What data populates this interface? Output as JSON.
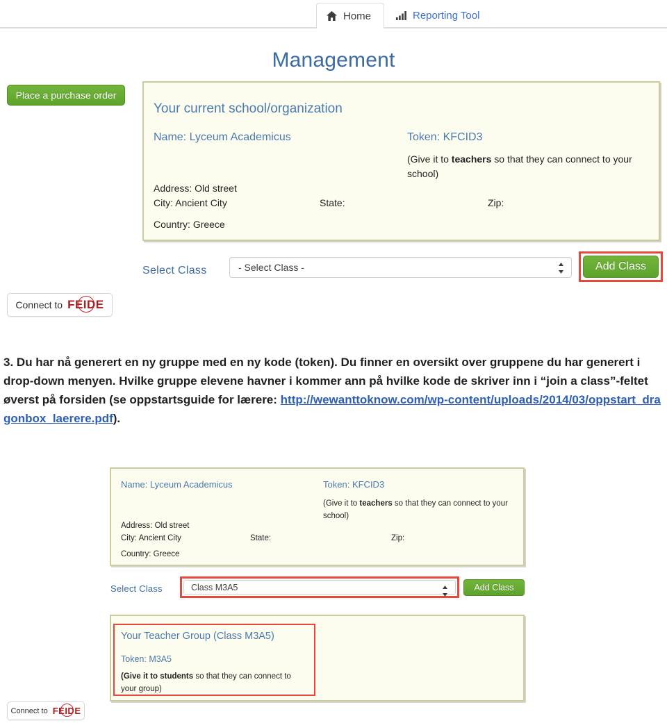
{
  "tabs": [
    {
      "label": "Home",
      "icon": "home-icon",
      "active": true
    },
    {
      "label": "Reporting Tool",
      "icon": "bar-chart-icon",
      "active": false
    }
  ],
  "page_title": "Management",
  "buttons": {
    "purchase_order": "Place a purchase order",
    "add_class": "Add Class",
    "connect_feide_prefix": "Connect to",
    "feide_wordmark": "FEIDE"
  },
  "org_panel": {
    "heading": "Your current school/organization",
    "name_label": "Name:",
    "name_value": "Lyceum Academicus",
    "token_label": "Token:",
    "token_value": "KFCID3",
    "token_note_prefix": "(Give it to ",
    "token_note_bold": "teachers",
    "token_note_suffix": " so that they can connect to your school)",
    "address_label": "Address:",
    "address_value": "Old street",
    "city_label": "City:",
    "city_value": "Ancient City",
    "state_label": "State:",
    "state_value": "",
    "zip_label": "Zip:",
    "zip_value": "",
    "country_label": "Country:",
    "country_value": "Greece"
  },
  "select_class": {
    "label": "Select Class",
    "value": "- Select Class -",
    "options": [
      "- Select Class -",
      "Class M3A5"
    ]
  },
  "instruction": {
    "number": "3.",
    "part1": "Du har nå generert en ny gruppe med en ny kode (token). Du finner en oversikt over gruppene du har generert i drop-down menyen. Hvilke gruppe elevene havner i kommer ann på hvilke kode de skriver inn i “join a class”-feltet øverst på forsiden (se oppstartsguide for lærere: ",
    "link_text": "http://wewanttoknow.com/wp-content/uploads/2014/03/oppstart_dragonbox_laerere.pdf",
    "part2": ")."
  },
  "screenshot2": {
    "org": {
      "name_label": "Name:",
      "name_value": "Lyceum Academicus",
      "token_label": "Token:",
      "token_value": "KFCID3",
      "token_note_prefix": "(Give it to ",
      "token_note_bold": "teachers",
      "token_note_suffix": " so that they can connect to your school)",
      "address_label": "Address:",
      "address_value": "Old street",
      "city_label": "City:",
      "city_value": "Ancient City",
      "state_label": "State:",
      "zip_label": "Zip:",
      "country_label": "Country:",
      "country_value": "Greece"
    },
    "select_class": {
      "label": "Select Class",
      "value": "Class M3A5"
    },
    "add_class": "Add Class",
    "group": {
      "title": "Your Teacher Group (Class M3A5)",
      "token_label": "Token:",
      "token_value": "M3A5",
      "note_bold": "(Give it to students",
      "note_rest": " so that they can connect to your group)"
    },
    "connect_feide_prefix": "Connect to",
    "feide_wordmark": "FEIDE"
  },
  "colors": {
    "accent_blue": "#4a79ad",
    "link_blue": "#2d5fb9",
    "panel_bg": "#fdfdef",
    "panel_border": "#cdca9d",
    "green_button": "#5da32c",
    "highlight_red": "#e8483c",
    "feide_red": "#a41e22"
  }
}
